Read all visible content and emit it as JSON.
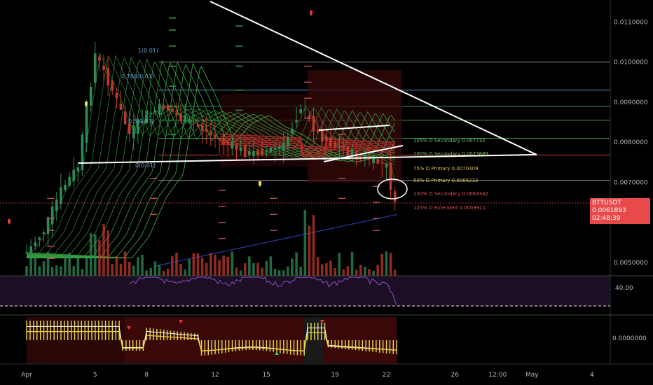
{
  "chart_data": {
    "type": "candlestick",
    "symbol": "BTTUSDT",
    "last_price": "0.0061893",
    "countdown": "02:48:39",
    "y_axis_ticks": [
      "0.0110000",
      "0.0100000",
      "0.0090000",
      "0.0080000",
      "0.0070000",
      "0.0050000"
    ],
    "ylim": [
      0.00465,
      0.01155
    ],
    "x_axis_ticks": [
      {
        "label": "Apr",
        "day": 1
      },
      {
        "label": "5",
        "day": 5
      },
      {
        "label": "8",
        "day": 8
      },
      {
        "label": "12",
        "day": 12
      },
      {
        "label": "15",
        "day": 15
      },
      {
        "label": "19",
        "day": 19
      },
      {
        "label": "22",
        "day": 22
      },
      {
        "label": "26",
        "day": 26
      },
      {
        "label": "12:00",
        "day": 28.5
      },
      {
        "label": "May",
        "day": 30.5
      },
      {
        "label": "4",
        "day": 34
      }
    ],
    "horizontal_levels": [
      {
        "price": 0.01,
        "color": "#8a8a8a"
      },
      {
        "price": 0.0093,
        "color": "#4a90c8"
      },
      {
        "price": 0.0089,
        "color": "#3b8f6a"
      },
      {
        "price": 0.00855,
        "color": "#3f9a4a"
      },
      {
        "price": 0.0081,
        "color": "#3f9a4a"
      },
      {
        "price": 0.00768,
        "color": "#d9423a"
      },
      {
        "price": 0.00705,
        "color": "#8a8a8a"
      }
    ],
    "fib_labels": [
      "1(0.01)",
      "0.786(0.01)",
      "0.5(0.01)",
      "0(0.01)"
    ],
    "level_labels": [
      {
        "text": "125% D Secondary 0.007732",
        "color": "#6fbf6f"
      },
      {
        "text": "100% D Secondary 0.0073889",
        "color": "#6fbf6f"
      },
      {
        "text": "75% D Primary 0.0070409",
        "color": "#d6c35a"
      },
      {
        "text": "50% D Primary 0.0066232",
        "color": "#d6c35a"
      },
      {
        "text": "100% D Secondary 0.0063342",
        "color": "#e05050"
      },
      {
        "text": "125% D Extended 0.0059911",
        "color": "#e05050"
      }
    ],
    "price_series_day_close": [
      {
        "day": 1,
        "close": 0.00525
      },
      {
        "day": 2,
        "close": 0.0058
      },
      {
        "day": 3,
        "close": 0.0068
      },
      {
        "day": 4,
        "close": 0.0074
      },
      {
        "day": 5,
        "close": 0.0102
      },
      {
        "day": 6,
        "close": 0.0093
      },
      {
        "day": 7,
        "close": 0.0082
      },
      {
        "day": 8,
        "close": 0.0087
      },
      {
        "day": 9,
        "close": 0.0089
      },
      {
        "day": 10,
        "close": 0.0086
      },
      {
        "day": 11,
        "close": 0.0084
      },
      {
        "day": 12,
        "close": 0.0081
      },
      {
        "day": 13,
        "close": 0.0079
      },
      {
        "day": 14,
        "close": 0.0077
      },
      {
        "day": 15,
        "close": 0.0078
      },
      {
        "day": 16,
        "close": 0.0079
      },
      {
        "day": 17,
        "close": 0.0089
      },
      {
        "day": 18,
        "close": 0.0082
      },
      {
        "day": 19,
        "close": 0.0079
      },
      {
        "day": 20,
        "close": 0.0077
      },
      {
        "day": 21,
        "close": 0.0076
      },
      {
        "day": 22,
        "close": 0.0074
      },
      {
        "day": 22.6,
        "close": 0.0061893
      }
    ],
    "rsi_panel": {
      "level_label": "40.00"
    },
    "macd_panel": {
      "zero_label": "0.0000000"
    }
  },
  "colors": {
    "background": "#000000",
    "bull": "#2e8b57",
    "bear": "#c0392b",
    "ribbon_green": "#3cb043",
    "ribbon_red": "#c0282d",
    "rsi": "#8a4fc8",
    "rsi_bg": "#1c0f24",
    "macd_hist": "#e8e04a",
    "trendline": "#ffffff",
    "badge": "#e8494a"
  }
}
